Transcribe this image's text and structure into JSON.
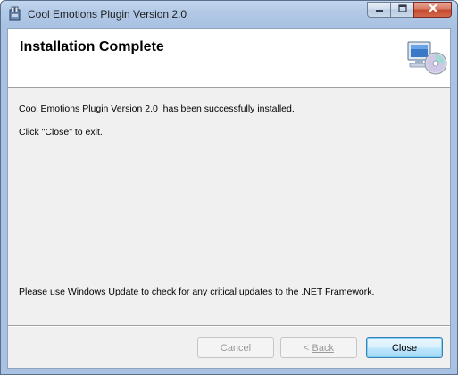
{
  "window": {
    "title": "Cool Emotions Plugin Version 2.0",
    "icon": "installer-icon"
  },
  "caption_buttons": {
    "minimize_icon": "minimize-icon",
    "maximize_icon": "maximize-icon",
    "close_icon": "close-icon"
  },
  "banner": {
    "title": "Installation Complete",
    "icon": "computer-cd-icon"
  },
  "body": {
    "line1": "Cool Emotions Plugin Version 2.0  has been successfully installed.",
    "line2": "Click \"Close\" to exit.",
    "footer_note": "Please use Windows Update to check for any critical updates to the .NET Framework."
  },
  "buttons": {
    "cancel": "Cancel",
    "back_prefix": "< ",
    "back_label": "Back",
    "close": "Close"
  },
  "colors": {
    "accent": "#3c7fb1",
    "close_button_red": "#c4482c"
  }
}
